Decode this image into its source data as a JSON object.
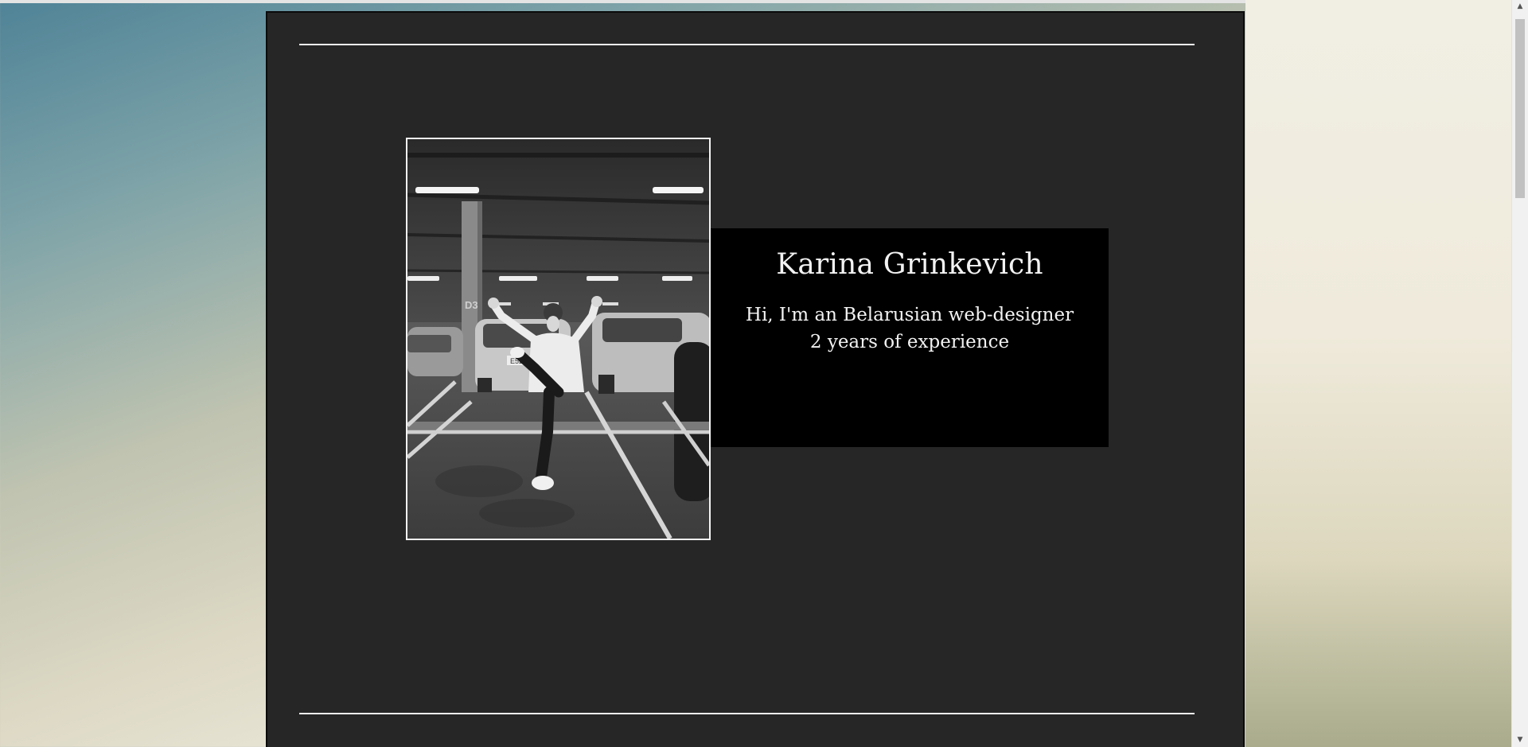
{
  "profile": {
    "name": "Karina Grinkevich",
    "tagline": "Hi, I'm an Belarusian web-designer",
    "experience": "2 years of experience"
  },
  "photo": {
    "icon": "portrait-photo",
    "parking_sign": "D3",
    "plate": "E520"
  },
  "colors": {
    "panel": "#262626",
    "intro_box": "#000000",
    "text": "#f2f2f2"
  }
}
